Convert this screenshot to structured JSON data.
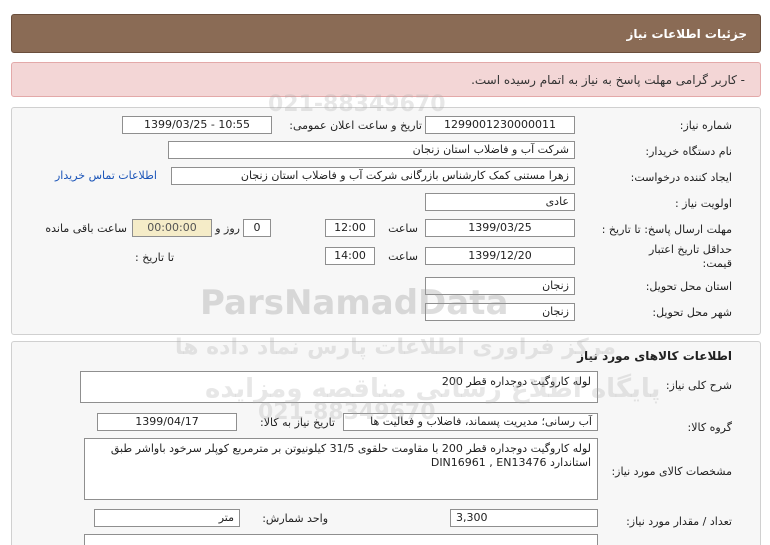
{
  "header": {
    "title": "جزئیات اطلاعات نیاز"
  },
  "alert": {
    "message": "- کاربر گرامی مهلت پاسخ به نیاز به اتمام رسیده است."
  },
  "details": {
    "need_number_label": "شماره نیاز:",
    "need_number": "1299001230000011",
    "announce_label": "تاریخ و ساعت اعلان عمومی:",
    "announce_value": "1399/03/25 - 10:55",
    "buyer_label": "نام دستگاه خریدار:",
    "buyer": "شرکت آب و فاضلاب استان زنجان",
    "creator_label": "ایجاد کننده درخواست:",
    "creator": "زهرا مستنی کمک کارشناس بازرگانی شرکت آب و فاضلاب استان زنجان",
    "contact_link": "اطلاعات تماس خریدار",
    "priority_label": "اولویت نیاز :",
    "priority": "عادی",
    "deadline_label": "مهلت ارسال پاسخ:  تا تاریخ :",
    "deadline_date": "1399/03/25",
    "time_label": "ساعت",
    "deadline_time": "12:00",
    "days_value": "0",
    "days_label": "روز و",
    "remaining_value": "00:00:00",
    "remaining_label": "ساعت باقی مانده",
    "validity_label_1": "حداقل تاریخ اعتبار",
    "validity_label_2": "قیمت:",
    "validity_until": "تا تاریخ :",
    "validity_date": "1399/12/20",
    "validity_time_label": "ساعت",
    "validity_time": "14:00",
    "province_label": "استان محل تحویل:",
    "province": "زنجان",
    "city_label": "شهر محل تحویل:",
    "city": "زنجان"
  },
  "goods": {
    "section_title": "اطلاعات کالاهای مورد نیاز",
    "summary_label": "شرح کلی نیاز:",
    "summary": "لوله کاروگیت دوجداره قطر 200",
    "group_label": "گروه کالا:",
    "group": "آب رسانی؛ مدیریت پسماند، فاضلاب و فعالیت ها",
    "need_date_label": "تاریخ نیاز به کالا:",
    "need_date": "1399/04/17",
    "spec_label": "مشخصات کالای مورد نیاز:",
    "spec": "لوله کاروگیت دوجداره قطر 200 با مقاومت حلقوی 31/5 کیلونیوتن بر مترمربع کوپلر سرخود باواشر طبق استاندارد DIN16961 , EN13476",
    "qty_label": "تعداد / مقدار مورد نیاز:",
    "qty": "3,300",
    "unit_label": "واحد شمارش:",
    "unit": "متر"
  },
  "watermark": {
    "line1": "مرکز فراوری اطلاعات پارس نماد داده ها",
    "line2": "ParsNamadData",
    "line3": "پایگاه اطلاع رسانی مناقصه ومزایده",
    "phone1": "021-88349670",
    "phone2": "021-88349670"
  }
}
